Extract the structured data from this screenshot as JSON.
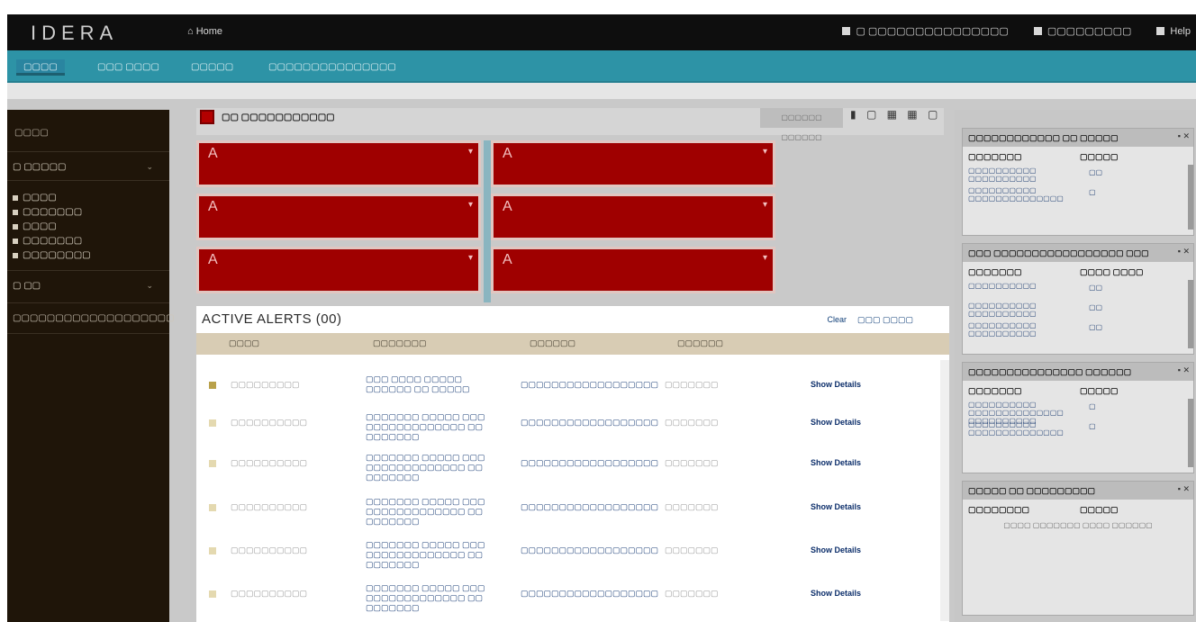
{
  "app": {
    "logo": "IDERA",
    "home_link": "⌂ Home",
    "user_server": "▢ ▢▢▢▢▢▢▢▢▢▢▢▢▢▢▢",
    "user_name": "▢▢▢▢▢▢▢▢▢",
    "help": "Help"
  },
  "nav": {
    "tabs": [
      {
        "label": "▢▢▢▢"
      },
      {
        "label": "▢▢▢ ▢▢▢▢"
      },
      {
        "label": "▢▢▢▢▢"
      },
      {
        "label": "▢▢▢▢▢▢▢▢▢▢▢▢▢▢▢"
      }
    ]
  },
  "sidebar": {
    "title": "▢▢▢▢",
    "group1": "▢ ▢▢▢▢▢",
    "items": [
      {
        "label": "▢▢▢▢"
      },
      {
        "label": "▢▢▢▢▢▢▢"
      },
      {
        "label": "▢▢▢▢"
      },
      {
        "label": "▢▢▢▢▢▢▢"
      },
      {
        "label": "▢▢▢▢▢▢▢▢"
      }
    ],
    "group2": "▢ ▢▢",
    "footer": "▢▢▢▢▢▢▢▢▢▢▢▢▢▢▢▢▢▢▢"
  },
  "instance": {
    "name": "▢▢ ▢▢▢▢▢▢▢▢▢▢▢",
    "toolbar_label": "▢▢▢▢▢▢ ▢▢▢▢▢▢",
    "icons": "▮ ▢ ▦ ▦ ▢"
  },
  "tiles": [
    {
      "letter": "A",
      "caret": "▾"
    },
    {
      "letter": "A",
      "caret": "▾"
    },
    {
      "letter": "A",
      "caret": "▾"
    },
    {
      "letter": "A",
      "caret": "▾"
    },
    {
      "letter": "A",
      "caret": "▾"
    },
    {
      "letter": "A",
      "caret": "▾"
    }
  ],
  "alerts": {
    "title": "ACTIVE ALERTS (00)",
    "action_clear": "Clear",
    "action_view": "▢▢▢ ▢▢▢▢",
    "columns": [
      "▢▢▢▢",
      "▢▢▢▢▢▢▢",
      "▢▢▢▢▢▢",
      "▢▢▢▢▢▢"
    ],
    "rows": [
      {
        "date": "▢▢▢▢▢▢▢▢▢",
        "summary": "▢▢▢ ▢▢▢▢ ▢▢▢▢▢ ▢▢▢▢▢▢ ▢▢ ▢▢▢▢▢",
        "instance": "▢▢▢▢▢▢▢▢▢▢▢▢▢▢▢▢▢▢",
        "source": "▢▢▢▢▢▢▢",
        "link": "Show Details",
        "sev": "#b9a14a"
      },
      {
        "date": "▢▢▢▢▢▢▢▢▢▢",
        "summary": "▢▢▢▢▢▢▢ ▢▢▢▢▢ ▢▢▢ ▢▢▢▢▢▢▢▢▢▢▢▢▢ ▢▢ ▢▢▢▢▢▢▢",
        "instance": "▢▢▢▢▢▢▢▢▢▢▢▢▢▢▢▢▢▢",
        "source": "▢▢▢▢▢▢▢",
        "link": "Show Details",
        "sev": "#e4d9b0"
      },
      {
        "date": "▢▢▢▢▢▢▢▢▢▢",
        "summary": "▢▢▢▢▢▢▢ ▢▢▢▢▢ ▢▢▢ ▢▢▢▢▢▢▢▢▢▢▢▢▢ ▢▢ ▢▢▢▢▢▢▢",
        "instance": "▢▢▢▢▢▢▢▢▢▢▢▢▢▢▢▢▢▢",
        "source": "▢▢▢▢▢▢▢",
        "link": "Show Details",
        "sev": "#e4d9b0"
      },
      {
        "date": "▢▢▢▢▢▢▢▢▢▢",
        "summary": "▢▢▢▢▢▢▢ ▢▢▢▢▢ ▢▢▢ ▢▢▢▢▢▢▢▢▢▢▢▢▢ ▢▢ ▢▢▢▢▢▢▢",
        "instance": "▢▢▢▢▢▢▢▢▢▢▢▢▢▢▢▢▢▢",
        "source": "▢▢▢▢▢▢▢",
        "link": "Show Details",
        "sev": "#e4d9b0"
      },
      {
        "date": "▢▢▢▢▢▢▢▢▢▢",
        "summary": "▢▢▢▢▢▢▢ ▢▢▢▢▢ ▢▢▢ ▢▢▢▢▢▢▢▢▢▢▢▢▢ ▢▢ ▢▢▢▢▢▢▢",
        "instance": "▢▢▢▢▢▢▢▢▢▢▢▢▢▢▢▢▢▢",
        "source": "▢▢▢▢▢▢▢",
        "link": "Show Details",
        "sev": "#e4d9b0"
      },
      {
        "date": "▢▢▢▢▢▢▢▢▢▢",
        "summary": "▢▢▢▢▢▢▢ ▢▢▢▢▢ ▢▢▢ ▢▢▢▢▢▢▢▢▢▢▢▢▢ ▢▢ ▢▢▢▢▢▢▢",
        "instance": "▢▢▢▢▢▢▢▢▢▢▢▢▢▢▢▢▢▢",
        "source": "▢▢▢▢▢▢▢",
        "link": "Show Details",
        "sev": "#e4d9b0"
      }
    ]
  },
  "right_widgets": [
    {
      "title": "▢▢▢▢▢▢▢▢▢▢▢▢ ▢▢ ▢▢▢▢▢",
      "col1": "▢▢▢▢▢▢▢",
      "col2": "▢▢▢▢▢",
      "lines": [
        "▢▢▢▢▢▢▢▢▢▢ ▢▢▢▢▢▢▢▢▢▢",
        "▢▢▢▢▢▢▢▢▢▢ ▢▢▢▢▢▢▢▢▢▢▢▢▢▢"
      ],
      "vals": [
        "▢▢",
        "▢"
      ]
    },
    {
      "title": "▢▢▢ ▢▢▢▢▢▢▢▢▢▢▢▢▢▢▢▢▢ ▢▢▢",
      "col1": "▢▢▢▢▢▢▢",
      "col2": "▢▢▢▢ ▢▢▢▢",
      "lines": [
        "▢▢▢▢▢▢▢▢▢▢",
        "▢▢▢▢▢▢▢▢▢▢ ▢▢▢▢▢▢▢▢▢▢",
        "▢▢▢▢▢▢▢▢▢▢ ▢▢▢▢▢▢▢▢▢▢"
      ],
      "vals": [
        "▢▢",
        "▢▢",
        "▢▢"
      ]
    },
    {
      "title": "▢▢▢▢▢▢▢▢▢▢▢▢▢▢▢ ▢▢▢▢▢▢",
      "col1": "▢▢▢▢▢▢▢",
      "col2": "▢▢▢▢▢",
      "lines": [
        "▢▢▢▢▢▢▢▢▢▢ ▢▢▢▢▢▢▢▢▢▢▢▢▢▢ ▢▢▢▢▢▢▢▢▢▢",
        "▢▢▢▢▢▢▢▢▢▢ ▢▢▢▢▢▢▢▢▢▢▢▢▢▢"
      ],
      "vals": [
        "▢",
        "▢"
      ]
    },
    {
      "title": "▢▢▢▢▢ ▢▢ ▢▢▢▢▢▢▢▢▢",
      "col1": "▢▢▢▢▢▢▢▢",
      "col2": "▢▢▢▢▢",
      "lines": [],
      "vals": [],
      "empty": "▢▢▢▢ ▢▢▢▢▢▢▢ ▢▢▢▢ ▢▢▢▢▢▢"
    }
  ]
}
